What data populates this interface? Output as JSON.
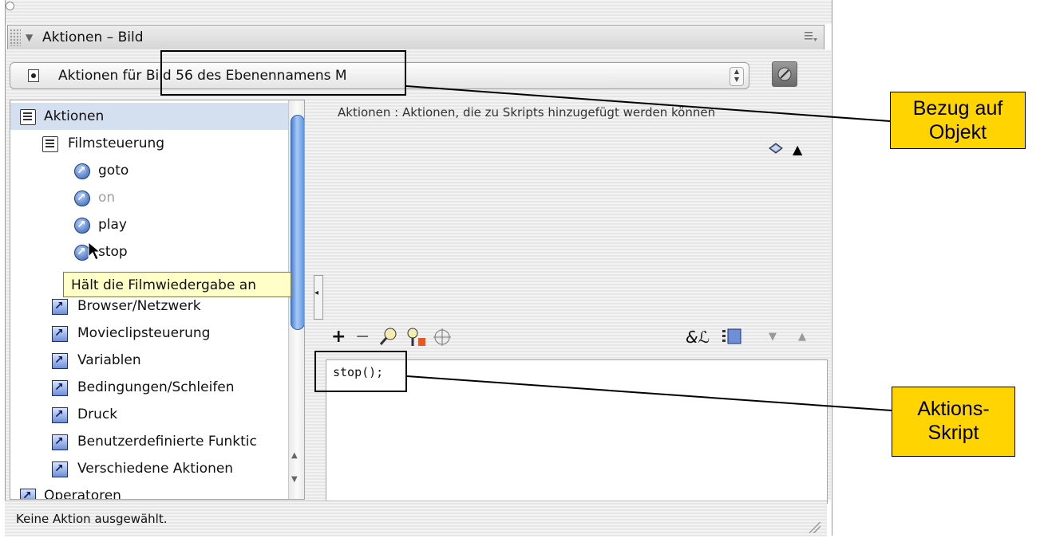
{
  "panel": {
    "title": "Aktionen – Bild"
  },
  "target": {
    "label": "Aktionen für Bild 56 des Ebenennamens M"
  },
  "tree": {
    "items": [
      {
        "label": "Aktionen",
        "icon": "book-icon",
        "selected": true
      },
      {
        "label": "Filmsteuerung",
        "icon": "book-icon"
      },
      {
        "label": "goto",
        "icon": "action-circle-icon"
      },
      {
        "label": "on",
        "icon": "action-circle-icon",
        "dimmed": true
      },
      {
        "label": "play",
        "icon": "action-circle-icon"
      },
      {
        "label": "stop",
        "icon": "action-circle-icon"
      },
      {
        "label": "Browser/Netzwerk",
        "icon": "category-square-icon"
      },
      {
        "label": "Movieclipsteuerung",
        "icon": "category-square-icon"
      },
      {
        "label": "Variablen",
        "icon": "category-square-icon"
      },
      {
        "label": "Bedingungen/Schleifen",
        "icon": "category-square-icon"
      },
      {
        "label": "Druck",
        "icon": "category-square-icon"
      },
      {
        "label": "Benutzerdefinierte Funktic",
        "icon": "category-square-icon"
      },
      {
        "label": "Verschiedene Aktionen",
        "icon": "category-square-icon"
      },
      {
        "label": "Operatoren",
        "icon": "category-square-icon"
      }
    ]
  },
  "tooltip": {
    "text": "Hält die Filmwiedergabe an"
  },
  "description": {
    "text": "Aktionen : Aktionen, die zu Skripts hinzugefügt werden können"
  },
  "code": {
    "text": "stop();"
  },
  "status": {
    "text": "Keine Aktion ausgewählt."
  },
  "callouts": {
    "target_reference": "Bezug auf Objekt",
    "action_script": "Aktions-Skript",
    "color": "#ffd400"
  },
  "colors": {
    "selection": "#d4dff0",
    "scroll_thumb": "#5d95e0",
    "tooltip_bg": "#ffffc8"
  }
}
